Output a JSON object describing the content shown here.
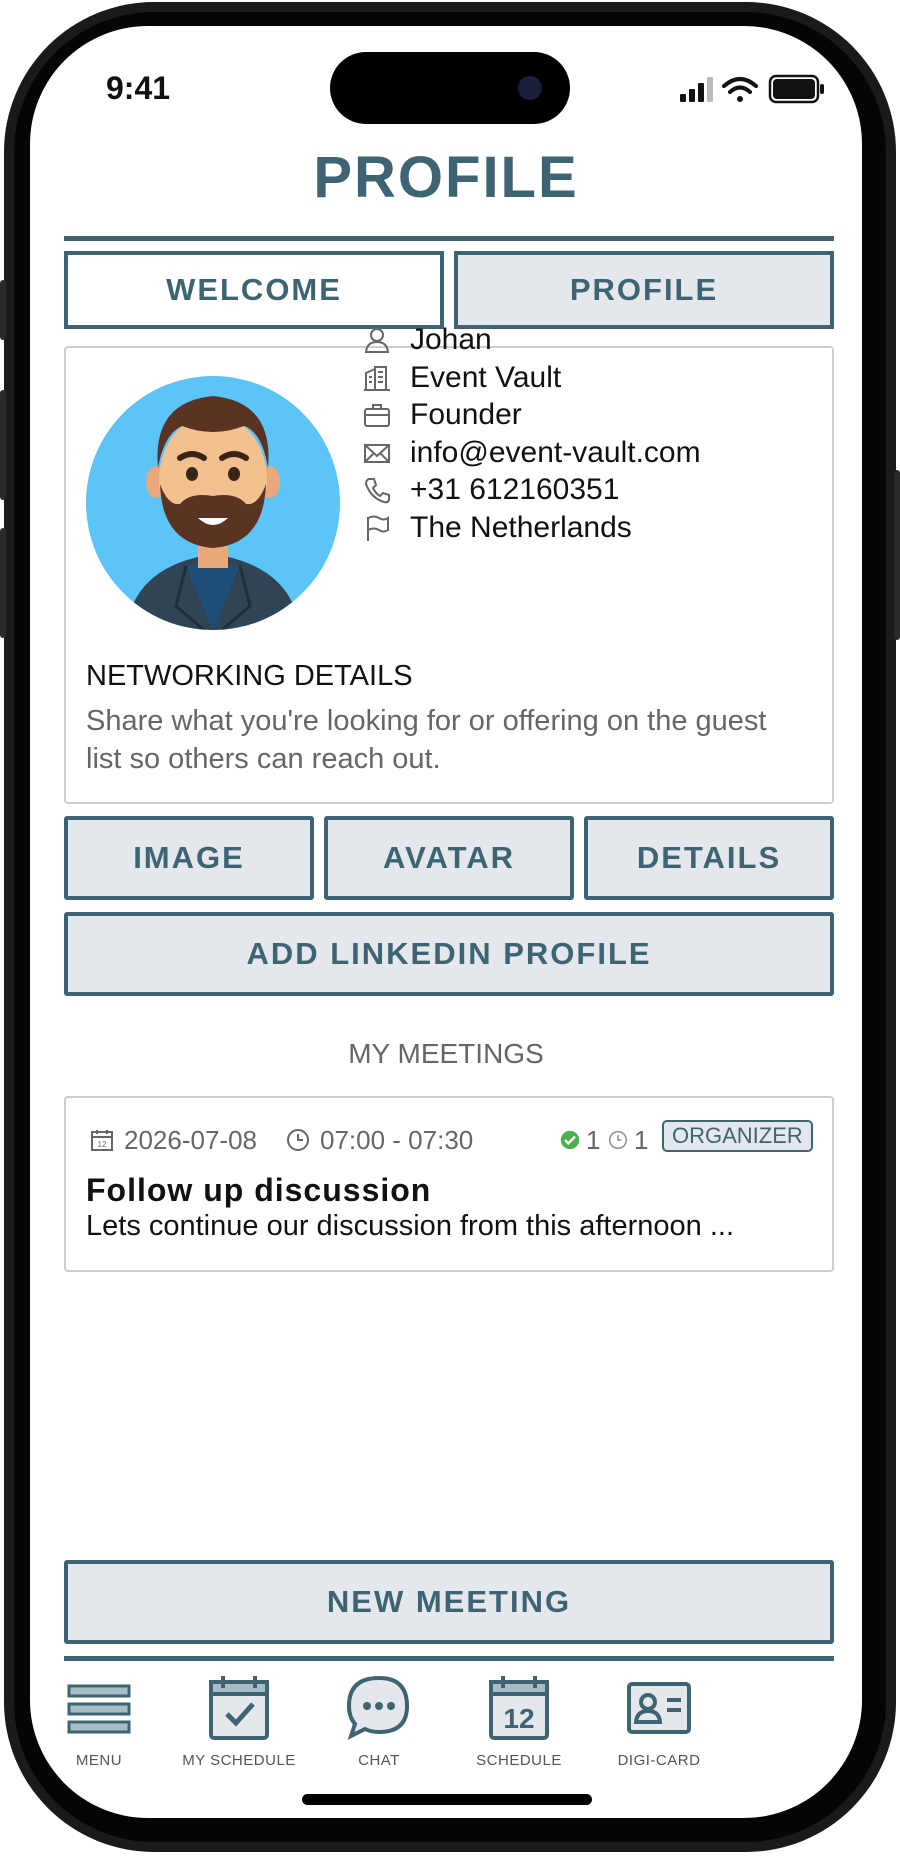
{
  "status": {
    "time": "9:41"
  },
  "page": {
    "title": "PROFILE"
  },
  "tabs": [
    {
      "label": "WELCOME"
    },
    {
      "label": "PROFILE"
    }
  ],
  "profile": {
    "name": "Johan",
    "company": "Event Vault",
    "role": "Founder",
    "email": "info@event-vault.com",
    "phone": "+31 612160351",
    "country": "The Netherlands"
  },
  "networking": {
    "title": "NETWORKING DETAILS",
    "text": "Share what you're looking for or offering on the guest list so others can reach out."
  },
  "actions": {
    "image": "IMAGE",
    "avatar": "AVATAR",
    "details": "DETAILS",
    "linkedin": "ADD LINKEDIN PROFILE"
  },
  "meetings": {
    "heading": "MY MEETINGS",
    "items": [
      {
        "date": "2026-07-08",
        "time": "07:00 - 07:30",
        "accepted": "1",
        "pending": "1",
        "badge": "ORGANIZER",
        "title": "Follow up discussion",
        "description": "Lets continue our discussion from this afternoon ..."
      }
    ]
  },
  "new_meeting": {
    "label": "NEW MEETING"
  },
  "nav": [
    {
      "label": "MENU",
      "icon": "hamburger-icon"
    },
    {
      "label": "MY SCHEDULE",
      "icon": "calendar-check-icon"
    },
    {
      "label": "CHAT",
      "icon": "chat-bubble-icon"
    },
    {
      "label": "SCHEDULE",
      "icon": "calendar-icon",
      "day": "12"
    },
    {
      "label": "DIGI-CARD",
      "icon": "id-card-icon"
    }
  ],
  "colors": {
    "accent": "#3e6474",
    "button_bg": "#e4e8ec",
    "avatar_bg": "#5cc4f7",
    "accepted": "#4caf50"
  }
}
